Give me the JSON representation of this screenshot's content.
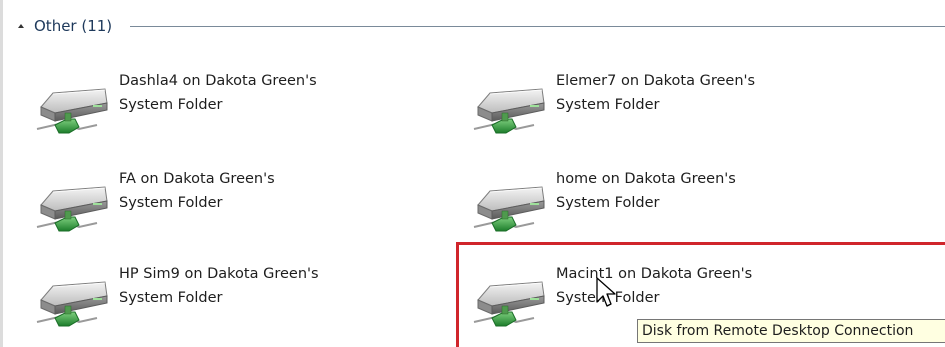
{
  "group": {
    "title": "Other (11)"
  },
  "items": [
    {
      "line1": "Dashla4 on Dakota Green's",
      "line2": "System Folder",
      "icon": "network-drive-icon"
    },
    {
      "line1": "Elemer7 on Dakota Green's",
      "line2": "System Folder",
      "icon": "network-drive-icon"
    },
    {
      "line1": "FA on Dakota Green's",
      "line2": "System Folder",
      "icon": "network-drive-icon"
    },
    {
      "line1": "home on Dakota Green's",
      "line2": "System Folder",
      "icon": "network-drive-icon"
    },
    {
      "line1": "HP Sim9 on Dakota Green's",
      "line2": "System Folder",
      "icon": "network-drive-icon"
    },
    {
      "line1": "Macint1 on Dakota Green's",
      "line2": "System Folder",
      "icon": "network-drive-icon"
    }
  ],
  "tooltip": {
    "text": "Disk from Remote Desktop Connection"
  },
  "colors": {
    "highlight": "#d0252b",
    "tooltip_bg": "#ffffe1",
    "header_text": "#1e395b",
    "drive_green": "#2f9e41"
  }
}
